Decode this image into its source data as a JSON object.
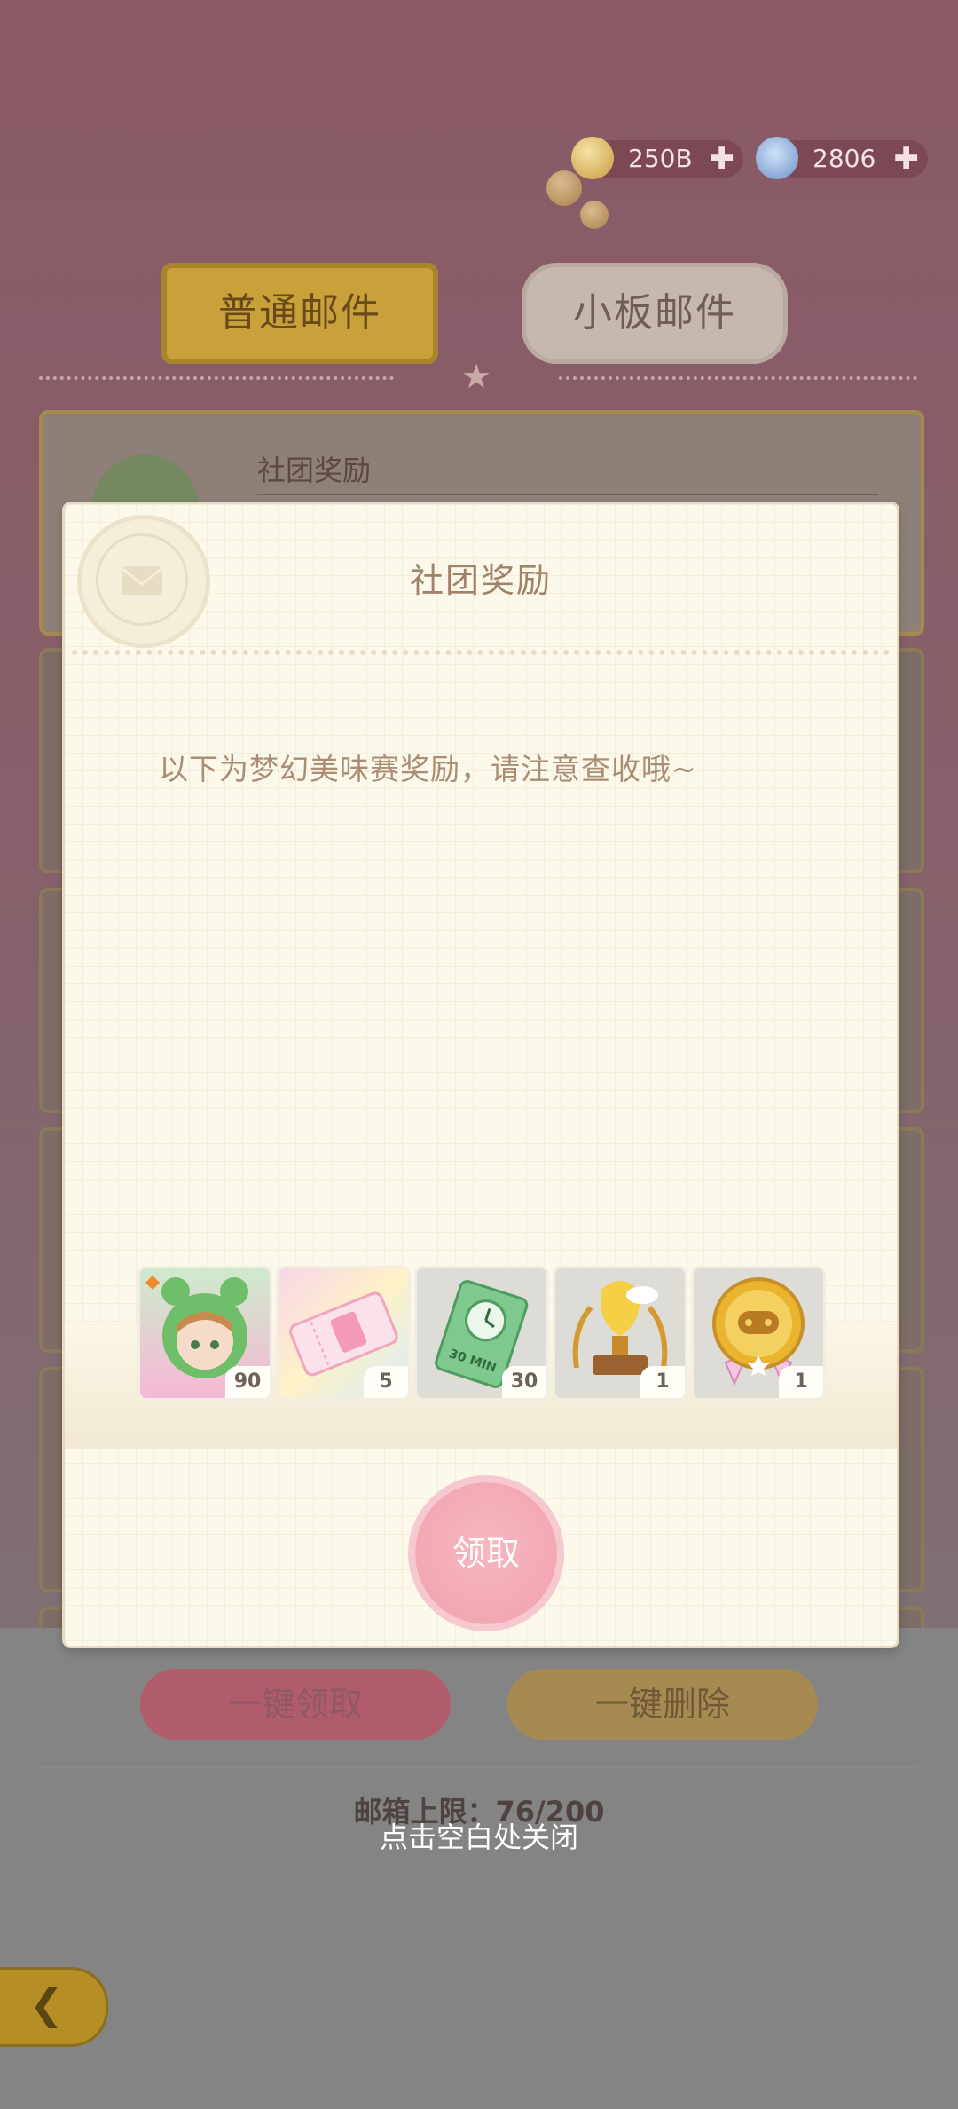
{
  "currency": {
    "coins": "250B",
    "gems": "2806",
    "coin_color": "#d8b24e",
    "gem_color": "#7aa6d8"
  },
  "tabs": [
    {
      "label": "普通邮件",
      "active": true
    },
    {
      "label": "小板邮件",
      "active": false
    }
  ],
  "mail_list": {
    "first_item_title": "社团奖励"
  },
  "dialog": {
    "title": "社团奖励",
    "body": "以下为梦幻美味赛奖励，请注意查收哦~",
    "rewards": [
      {
        "icon": "frog-hood-character-card-icon",
        "count": "90"
      },
      {
        "icon": "pink-ticket-icon",
        "count": "5"
      },
      {
        "icon": "30min-time-voucher-icon",
        "count": "30",
        "voucher_text": "30 MIN"
      },
      {
        "icon": "golden-trophy-icon",
        "count": "1"
      },
      {
        "icon": "gold-medal-icon",
        "count": "1"
      }
    ],
    "claim_label": "领取"
  },
  "footer": {
    "claim_all_label": "一键领取",
    "delete_all_label": "一键删除",
    "mailbox_limit": "邮箱上限：76/200",
    "close_hint": "点击空白处关闭"
  },
  "colors": {
    "accent_pink": "#f0a2ae",
    "gold_tab": "#c9a13a",
    "dialog_bg": "#fcf8ea"
  }
}
